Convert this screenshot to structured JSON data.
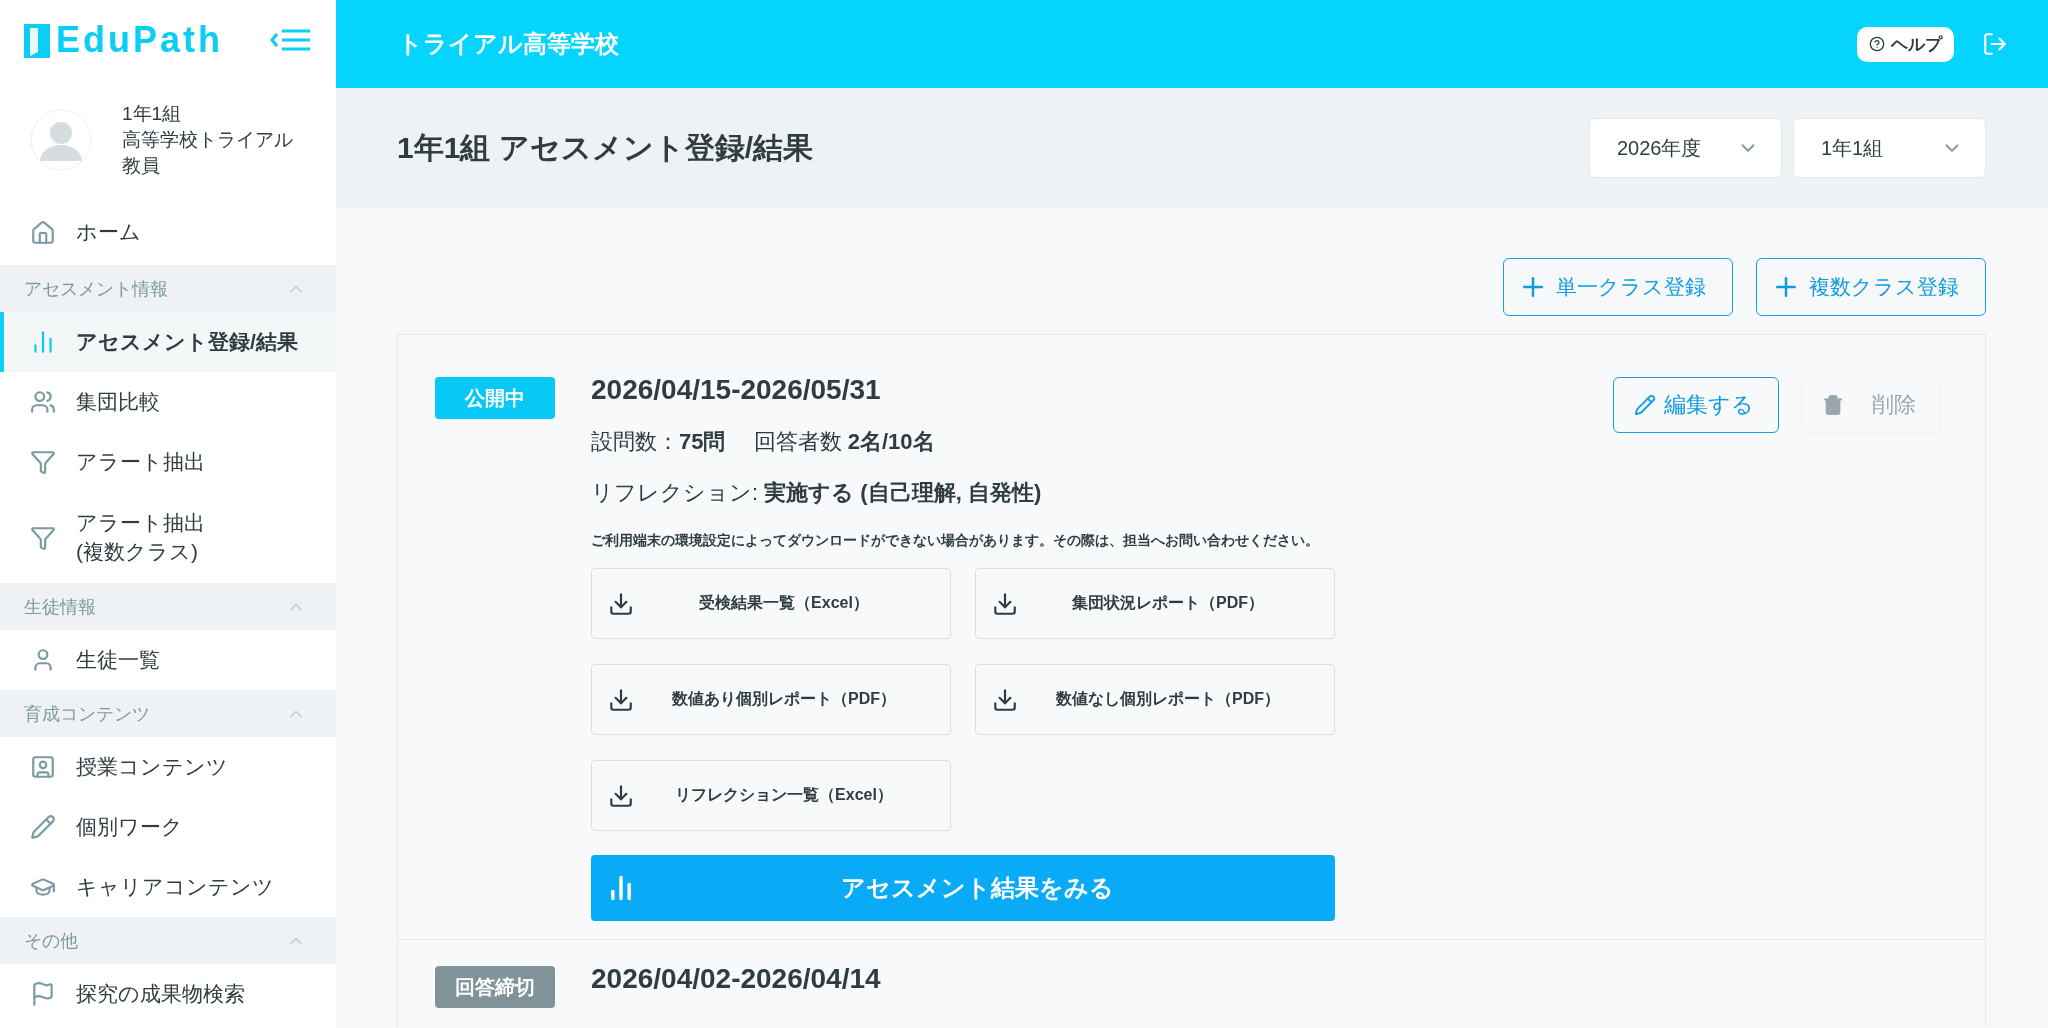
{
  "app": {
    "logo": "EduPath"
  },
  "user": {
    "class": "1年1組",
    "school": "高等学校トライアル",
    "role": "教員"
  },
  "nav": [
    {
      "kind": "link",
      "label": "ホーム",
      "selected": false
    },
    {
      "kind": "section",
      "label": "アセスメント情報",
      "expanded": true,
      "items": [
        {
          "label": "アセスメント登録/結果",
          "selected": true
        },
        {
          "label": "集団比較",
          "selected": false
        },
        {
          "label": "アラート抽出",
          "selected": false
        },
        {
          "label": "アラート抽出\n(複数クラス)",
          "selected": false
        }
      ]
    },
    {
      "kind": "section",
      "label": "生徒情報",
      "expanded": true,
      "items": [
        {
          "label": "生徒一覧",
          "selected": false
        }
      ]
    },
    {
      "kind": "section",
      "label": "育成コンテンツ",
      "expanded": true,
      "items": [
        {
          "label": "授業コンテンツ",
          "selected": false
        },
        {
          "label": "個別ワーク",
          "selected": false
        },
        {
          "label": "キャリアコンテンツ",
          "selected": false
        }
      ]
    },
    {
      "kind": "section",
      "label": "その他",
      "expanded": true,
      "items": [
        {
          "label": "探究の成果物検索",
          "selected": false
        }
      ]
    }
  ],
  "header": {
    "school": "トライアル高等学校",
    "help": "ヘルプ"
  },
  "page": {
    "title": "1年1組 アセスメント登録/結果",
    "selects": [
      {
        "value": "2026年度"
      },
      {
        "value": "1年1組"
      }
    ]
  },
  "actions": [
    "単一クラス登録",
    "複数クラス登録"
  ],
  "assessments": [
    {
      "status": {
        "label": "公開中",
        "kind": "open"
      },
      "period": "2026/04/15-2026/05/31",
      "questions_label": "設問数：",
      "questions": "75問",
      "respondents_label": "回答者数",
      "respondents": "2名/10名",
      "reflection_label": "リフレクション:",
      "reflection": "実施する (自己理解, 自発性)",
      "note": "ご利用端末の環境設定によってダウンロードができない場合があります。その際は、担当へお問い合わせください。",
      "downloads": [
        "受検結果一覧（Excel）",
        "集団状況レポート（PDF）",
        "数値あり個別レポート（PDF）",
        "数値なし個別レポート（PDF）",
        "リフレクション一覧（Excel）"
      ],
      "result_button": "アセスメント結果をみる",
      "edit": "編集する",
      "delete": {
        "label": "削除",
        "disabled": true
      }
    },
    {
      "status": {
        "label": "回答締切",
        "kind": "closed"
      },
      "period": "2026/04/02-2026/04/14"
    }
  ]
}
